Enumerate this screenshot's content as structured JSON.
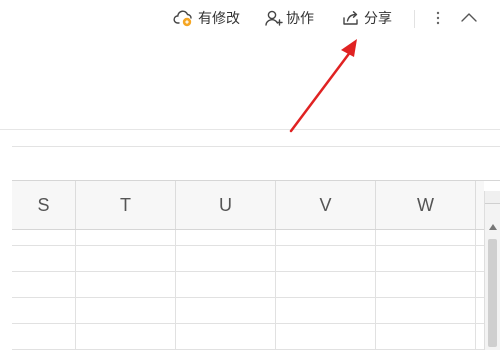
{
  "toolbar": {
    "modified_label": "有修改",
    "collab_label": "协作",
    "share_label": "分享",
    "icons": {
      "modified": "cloud-sync-icon",
      "collab": "user-add-icon",
      "share": "share-icon",
      "more": "more-vertical-icon",
      "collapse": "chevron-up-icon"
    }
  },
  "sheet": {
    "columns": [
      "S",
      "T",
      "U",
      "V",
      "W"
    ]
  },
  "annotation": {
    "arrow_color": "#e02222"
  },
  "colors": {
    "accent": "#f5a623"
  }
}
